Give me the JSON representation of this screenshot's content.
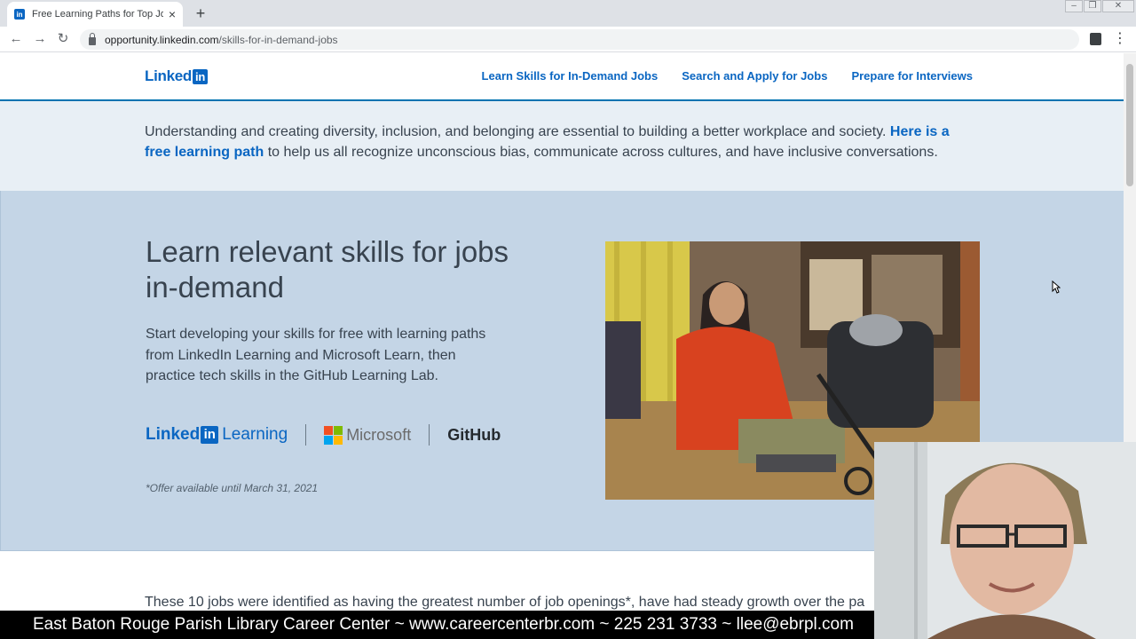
{
  "browser": {
    "tab_title": "Free Learning Paths for Top Jobs",
    "new_tab_icon": "+",
    "url_host": "opportunity.linkedin.com",
    "url_path": "/skills-for-in-demand-jobs"
  },
  "header": {
    "logo_text": "Linked",
    "logo_in": "in",
    "nav": [
      "Learn Skills for In-Demand Jobs",
      "Search and Apply for Jobs",
      "Prepare for Interviews"
    ]
  },
  "banner": {
    "text_before": "Understanding and creating diversity, inclusion, and belonging are essential to building a better workplace and society. ",
    "link_text": "Here is a free learning path",
    "text_after": " to help us all recognize unconscious bias, communicate across cultures, and have inclusive conversations."
  },
  "hero": {
    "title": "Learn relevant skills for jobs in-demand",
    "description": "Start developing your skills for free with learning paths from LinkedIn Learning and Microsoft Learn, then practice tech skills in the GitHub Learning Lab.",
    "partners": {
      "linkedin_learning": [
        "Linked",
        "in",
        "Learning"
      ],
      "microsoft": "Microsoft",
      "github": "GitHub"
    },
    "offer_note": "*Offer available until March 31, 2021"
  },
  "jobs_intro": "These 10 jobs were identified as having the greatest number of job openings*, have had steady growth over the pa",
  "caption": "East Baton Rouge Parish Library Career Center ~ www.careercenterbr.com ~ 225 231 3733 ~ llee@ebrpl.com",
  "colors": {
    "brand_blue": "#0a66c2",
    "banner_bg": "#e8eff5",
    "hero_bg": "#c4d5e6"
  }
}
